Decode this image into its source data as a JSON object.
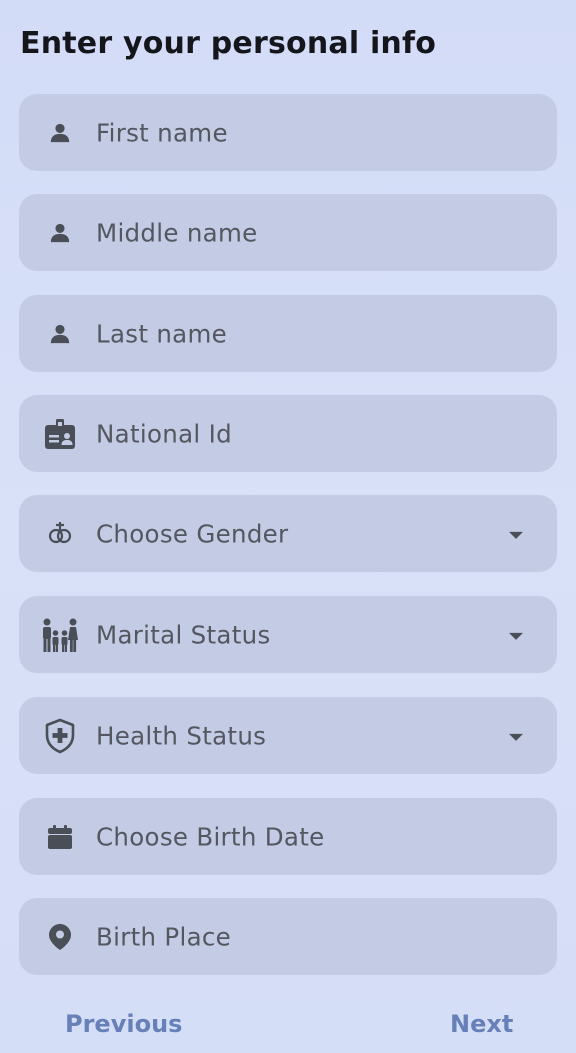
{
  "page": {
    "title": "Enter your personal info"
  },
  "fields": [
    {
      "id": "first_name",
      "placeholder": "First name",
      "icon": "person-icon",
      "dropdown": false
    },
    {
      "id": "middle_name",
      "placeholder": "Middle name",
      "icon": "person-icon",
      "dropdown": false
    },
    {
      "id": "last_name",
      "placeholder": "Last name",
      "icon": "person-icon",
      "dropdown": false
    },
    {
      "id": "national_id",
      "placeholder": "National Id",
      "icon": "id-badge-icon",
      "dropdown": false
    },
    {
      "id": "gender",
      "placeholder": "Choose Gender",
      "icon": "gender-icon",
      "dropdown": true
    },
    {
      "id": "marital_status",
      "placeholder": "Marital Status",
      "icon": "family-icon",
      "dropdown": true
    },
    {
      "id": "health_status",
      "placeholder": "Health Status",
      "icon": "health-shield-icon",
      "dropdown": true
    },
    {
      "id": "birth_date",
      "placeholder": "Choose Birth Date",
      "icon": "calendar-icon",
      "dropdown": false
    },
    {
      "id": "birth_place",
      "placeholder": "Birth Place",
      "icon": "location-pin-icon",
      "dropdown": false
    }
  ],
  "navigation": {
    "previous_label": "Previous",
    "next_label": "Next"
  },
  "colors": {
    "background": "#d6def7",
    "field_background": "#c3cce4",
    "title_text": "#14161c",
    "placeholder_text": "#54575f",
    "icon": "#4a4e57",
    "nav_accent": "#6780b8"
  }
}
